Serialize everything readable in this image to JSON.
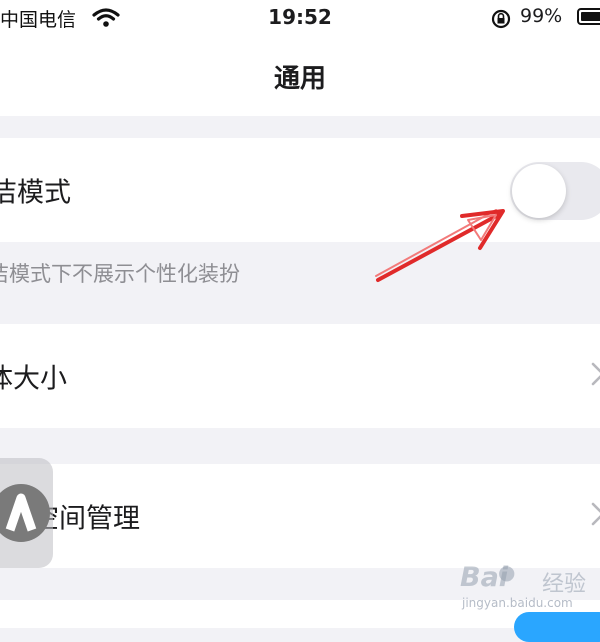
{
  "status_bar": {
    "carrier": "中国电信",
    "time": "19:52",
    "battery": "99%",
    "battery_level": 0.99,
    "icons": [
      "wifi-icon",
      "orientation-lock-icon",
      "battery-icon"
    ]
  },
  "nav": {
    "title": "通用"
  },
  "settings": {
    "simple_mode": {
      "label": "洁模式",
      "enabled": false
    },
    "simple_mode_note": "洁模式下不展示个性化装扮",
    "font_size": {
      "label": "体大小"
    },
    "space_manage": {
      "label": "空间管理"
    }
  },
  "overlay": {
    "arrow_color": "#e02a2a"
  },
  "watermark": {
    "logo": "Bai",
    "text": "经验",
    "url": "jingyan.baidu.com"
  },
  "colors": {
    "accent_blue": "#2aa6ff",
    "toggle_off": "#e9e9ee",
    "background": "#f2f2f6"
  }
}
